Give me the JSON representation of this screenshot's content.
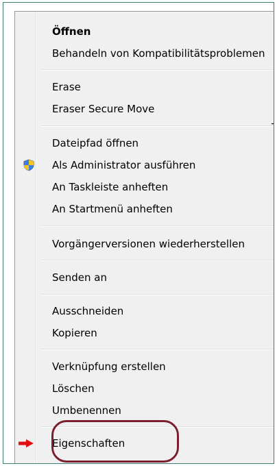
{
  "menu": {
    "items": [
      {
        "id": "oeffnen",
        "label": "Öffnen",
        "bold": true
      },
      {
        "id": "kompat",
        "label": "Behandeln von Kompatibilitätsproblemen"
      },
      {
        "id": "erase",
        "label": "Erase"
      },
      {
        "id": "eraser-move",
        "label": "Eraser Secure Move"
      },
      {
        "id": "dateipfad",
        "label": "Dateipfad öffnen"
      },
      {
        "id": "admin",
        "label": "Als Administrator ausführen"
      },
      {
        "id": "taskleiste",
        "label": "An Taskleiste anheften"
      },
      {
        "id": "startmenue",
        "label": "An Startmenü anheften"
      },
      {
        "id": "vorgaenger",
        "label": "Vorgängerversionen wiederherstellen"
      },
      {
        "id": "senden",
        "label": "Senden an"
      },
      {
        "id": "ausschneiden",
        "label": "Ausschneiden"
      },
      {
        "id": "kopieren",
        "label": "Kopieren"
      },
      {
        "id": "verknuepfung",
        "label": "Verknüpfung erstellen"
      },
      {
        "id": "loeschen",
        "label": "Löschen"
      },
      {
        "id": "umbenennen",
        "label": "Umbenennen"
      },
      {
        "id": "eigenschaften",
        "label": "Eigenschaften"
      }
    ],
    "truncated_char": "T"
  },
  "icons": {
    "admin_item": "uac-shield-icon",
    "eigenschaften_item": "red-arrow-icon"
  },
  "colors": {
    "highlight_ring": "#7a1f2f",
    "arrow": "#e01010",
    "frame_border": "#3a7d6e"
  }
}
